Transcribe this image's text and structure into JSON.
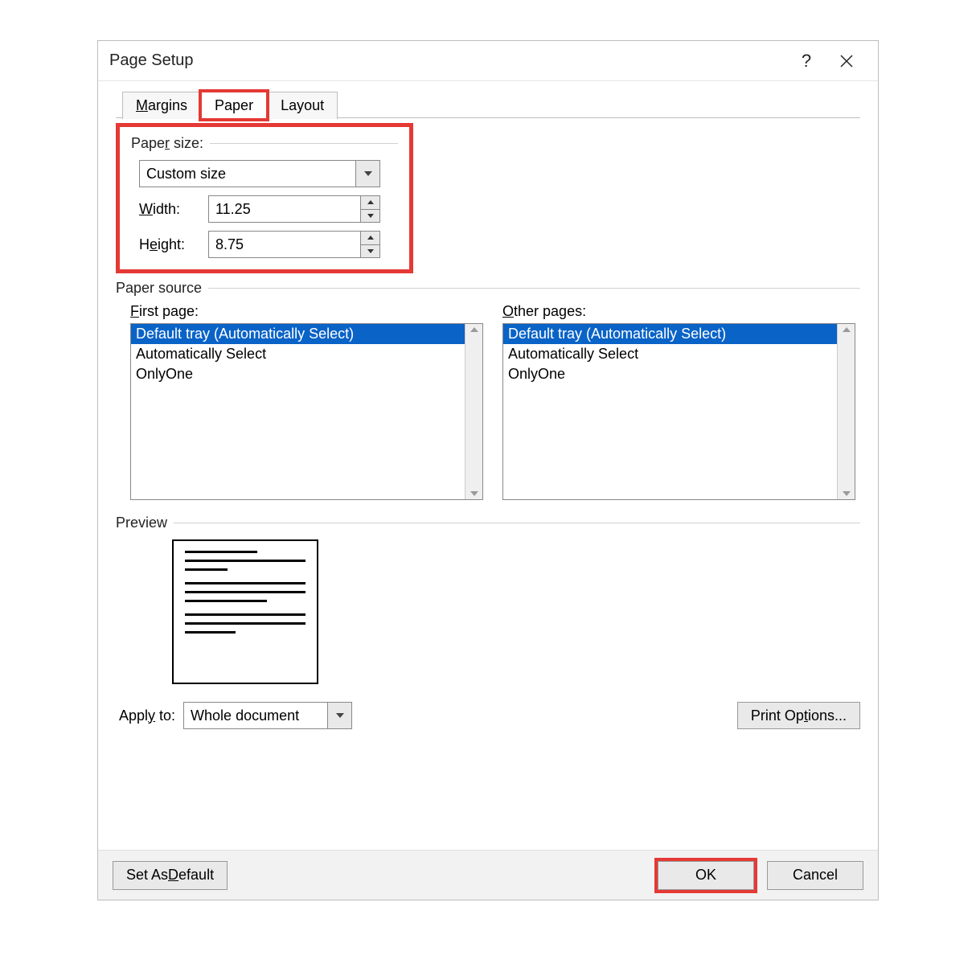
{
  "dialog": {
    "title": "Page Setup",
    "tabs": {
      "margins": "Margins",
      "paper": "Paper",
      "layout": "Layout",
      "active": "paper"
    },
    "paper_size": {
      "group_label": "Paper size:",
      "selected": "Custom size",
      "width_label": "Width:",
      "width_value": "11.25",
      "height_label": "Height:",
      "height_value": "8.75"
    },
    "paper_source": {
      "group_label": "Paper source",
      "first_page_label": "First page:",
      "other_pages_label": "Other pages:",
      "first_page_items": [
        "Default tray (Automatically Select)",
        "Automatically Select",
        "OnlyOne"
      ],
      "other_pages_items": [
        "Default tray (Automatically Select)",
        "Automatically Select",
        "OnlyOne"
      ],
      "first_selected_index": 0,
      "other_selected_index": 0
    },
    "preview_label": "Preview",
    "apply_to": {
      "label": "Apply to:",
      "value": "Whole document"
    },
    "print_options_label": "Print Options...",
    "footer": {
      "set_default": "Set As Default",
      "ok": "OK",
      "cancel": "Cancel"
    }
  }
}
